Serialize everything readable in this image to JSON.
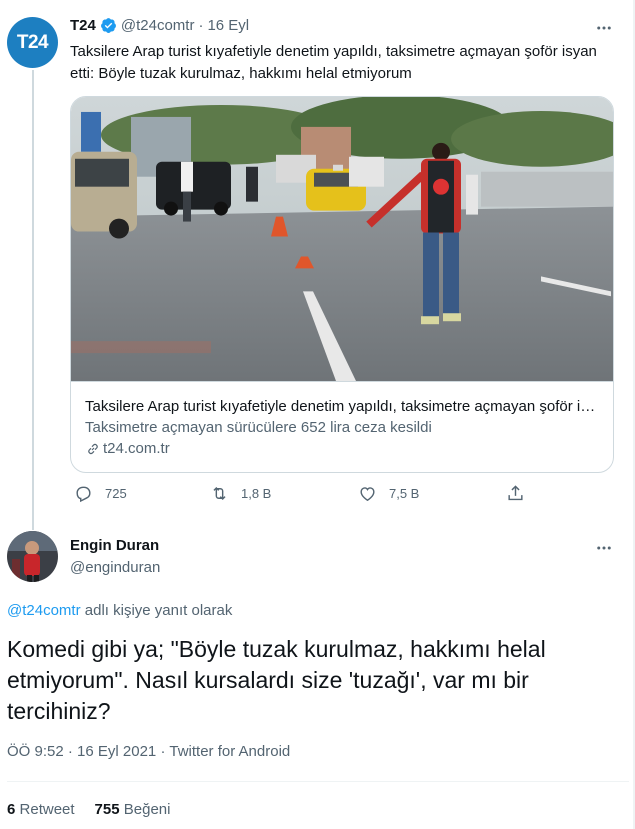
{
  "tweet": {
    "avatar_text": "T24",
    "display_name": "T24",
    "handle": "@t24comtr",
    "separator": "·",
    "date": "16 Eyl",
    "text": "Taksilere Arap turist kıyafetiyle denetim yapıldı, taksimetre açmayan şoför isyan etti: Böyle tuzak kurulmaz, hakkımı helal etmiyorum",
    "card": {
      "title": "Taksilere Arap turist kıyafetiyle denetim yapıldı, taksimetre açmayan şoför isyan etti",
      "description": "Taksimetre açmayan sürücülere 652 lira ceza kesildi",
      "domain": "t24.com.tr"
    },
    "actions": {
      "reply_count": "725",
      "retweet_count": "1,8 B",
      "like_count": "7,5 B"
    }
  },
  "reply": {
    "display_name": "Engin Duran",
    "handle": "@enginduran",
    "reply_to_handle": "@t24comtr",
    "reply_to_suffix": " adlı kişiye yanıt olarak",
    "text": "Komedi gibi ya; \"Böyle tuzak kurulmaz, hakkımı helal etmiyorum\". Nasıl kursalardı size 'tuzağı', var mı bir tercihiniz?",
    "time": "ÖÖ 9:52",
    "date": "16 Eyl 2021",
    "source": "Twitter for Android",
    "retweets_count": "6",
    "retweets_label": "Retweet",
    "likes_count": "755",
    "likes_label": "Beğeni"
  },
  "colors": {
    "accent": "#1d9bf0",
    "muted": "#536471",
    "border": "#cfd9de",
    "avatar_bg": "#1d7fc1"
  },
  "icons": [
    "verified-badge-icon",
    "more-icon",
    "reply-icon",
    "retweet-icon",
    "like-icon",
    "share-icon",
    "link-icon"
  ]
}
